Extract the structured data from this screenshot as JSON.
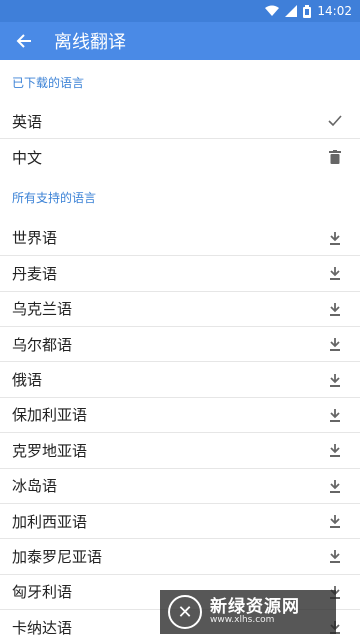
{
  "status_bar": {
    "time": "14:02"
  },
  "app_bar": {
    "title": "离线翻译"
  },
  "downloaded": {
    "header": "已下载的语言",
    "items": [
      {
        "label": "英语",
        "icon": "check-icon"
      },
      {
        "label": "中文",
        "icon": "trash-icon"
      }
    ]
  },
  "supported": {
    "header": "所有支持的语言",
    "items": [
      {
        "label": "世界语"
      },
      {
        "label": "丹麦语"
      },
      {
        "label": "乌克兰语"
      },
      {
        "label": "乌尔都语"
      },
      {
        "label": "俄语"
      },
      {
        "label": "保加利亚语"
      },
      {
        "label": "克罗地亚语"
      },
      {
        "label": "冰岛语"
      },
      {
        "label": "加利西亚语"
      },
      {
        "label": "加泰罗尼亚语"
      },
      {
        "label": "匈牙利语"
      },
      {
        "label": "卡纳达语"
      }
    ]
  },
  "watermark": {
    "title": "新绿资源网",
    "url": "www.xlhs.com"
  },
  "colors": {
    "status_bar": "#3f7fd9",
    "app_bar": "#4a8ae6",
    "section_header": "#3b82d6"
  }
}
